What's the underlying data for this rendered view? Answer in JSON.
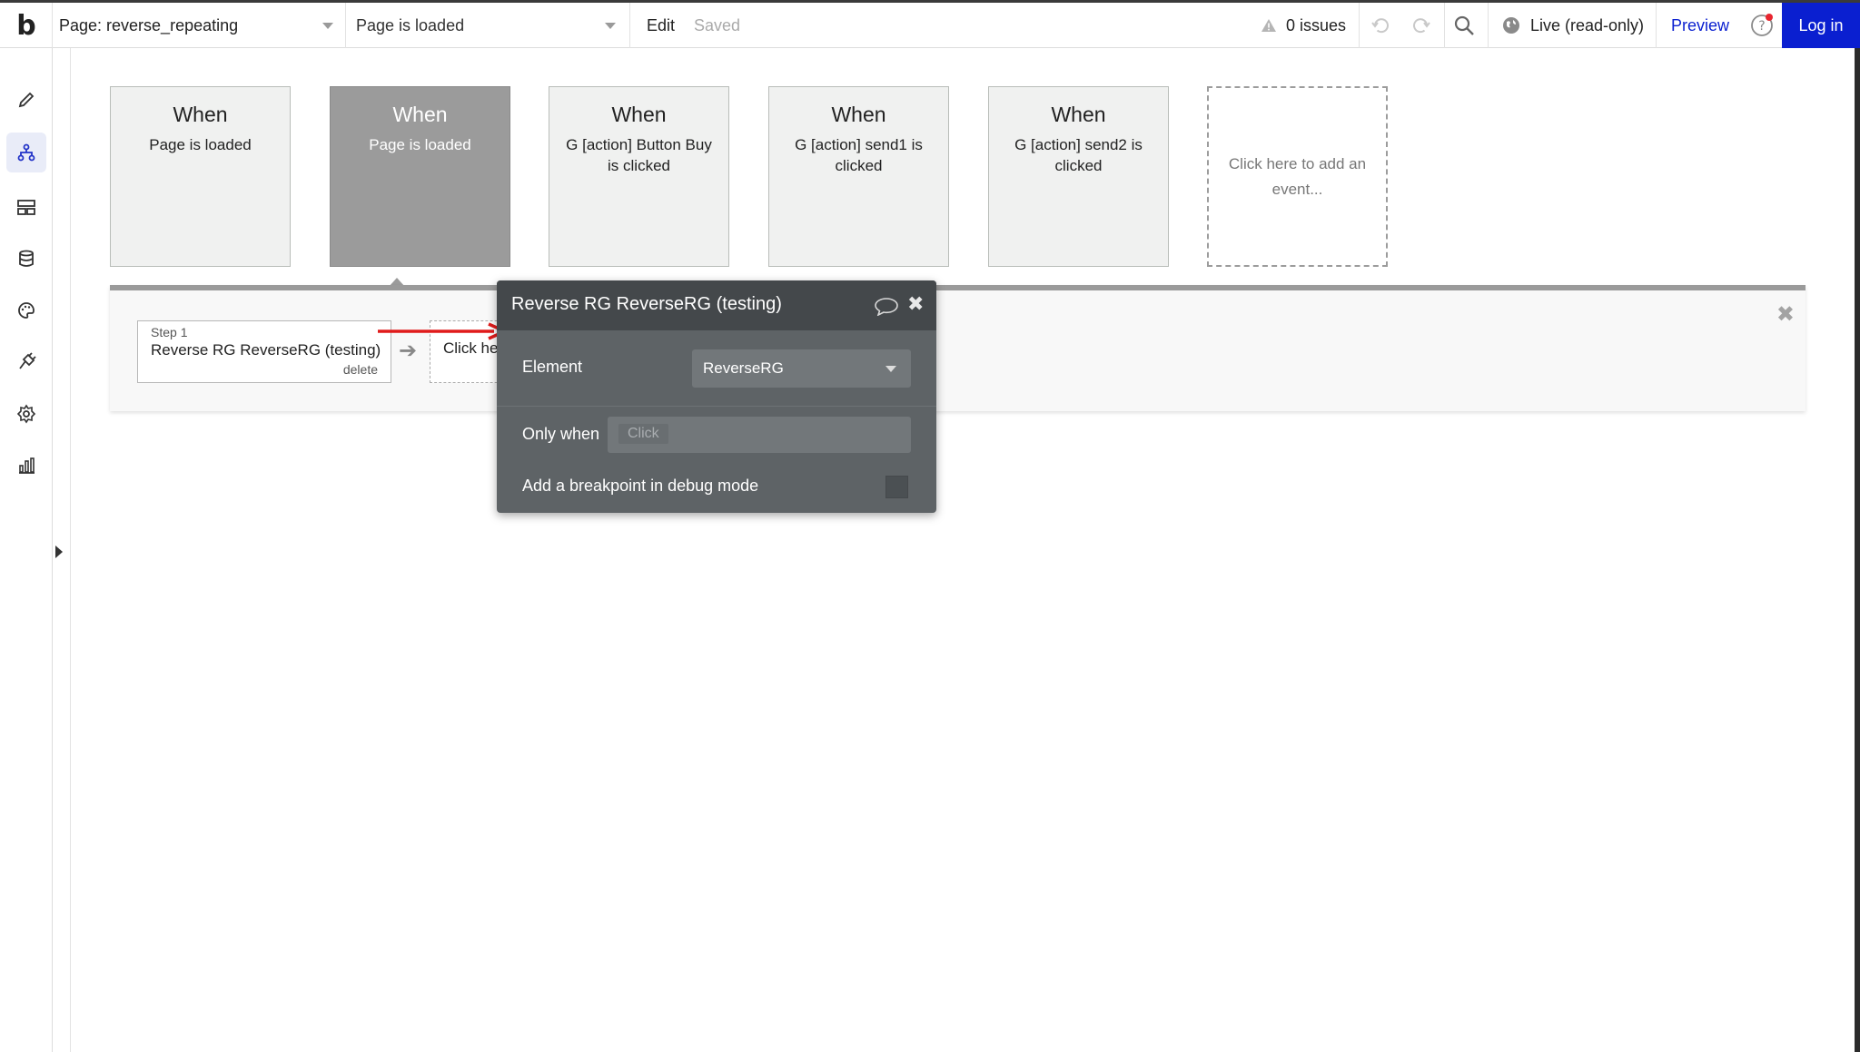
{
  "app": {
    "logo": "b"
  },
  "topbar": {
    "page_selector": "Page: reverse_repeating",
    "event_selector": "Page is loaded",
    "edit_label": "Edit",
    "saved_label": "Saved",
    "issues_label": "0 issues",
    "live_label": "Live (read-only)",
    "preview_label": "Preview",
    "help_label": "?",
    "login_label": "Log in",
    "accent": "#0a1fd0"
  },
  "sidebar": {
    "items": [
      {
        "icon": "pencil-icon",
        "name": "design"
      },
      {
        "icon": "workflow-icon",
        "name": "workflow",
        "active": true
      },
      {
        "icon": "layout-icon",
        "name": "styles"
      },
      {
        "icon": "database-icon",
        "name": "data"
      },
      {
        "icon": "palette-icon",
        "name": "palette"
      },
      {
        "icon": "plugin-icon",
        "name": "plugins"
      },
      {
        "icon": "gear-icon",
        "name": "settings"
      },
      {
        "icon": "chart-icon",
        "name": "logs"
      }
    ]
  },
  "events": [
    {
      "when": "When",
      "desc": "Page is loaded",
      "selected": false
    },
    {
      "when": "When",
      "desc": "Page is loaded",
      "selected": true
    },
    {
      "when": "When",
      "desc": "G [action] Button Buy is clicked",
      "selected": false
    },
    {
      "when": "When",
      "desc": "G [action] send1 is clicked",
      "selected": false
    },
    {
      "when": "When",
      "desc": "G [action] send2 is clicked",
      "selected": false
    }
  ],
  "add_event": "Click here to add an event...",
  "workflow": {
    "step_label": "Step 1",
    "step_name": "Reverse RG ReverseRG (testing)",
    "delete_label": "delete",
    "add_step_label": "Click here to add an action..."
  },
  "editor": {
    "title": "Reverse RG ReverseRG (testing)",
    "element_label": "Element",
    "element_value": "ReverseRG",
    "only_when_label": "Only when",
    "only_when_placeholder": "Click",
    "breakpoint_label": "Add a breakpoint in debug mode"
  }
}
